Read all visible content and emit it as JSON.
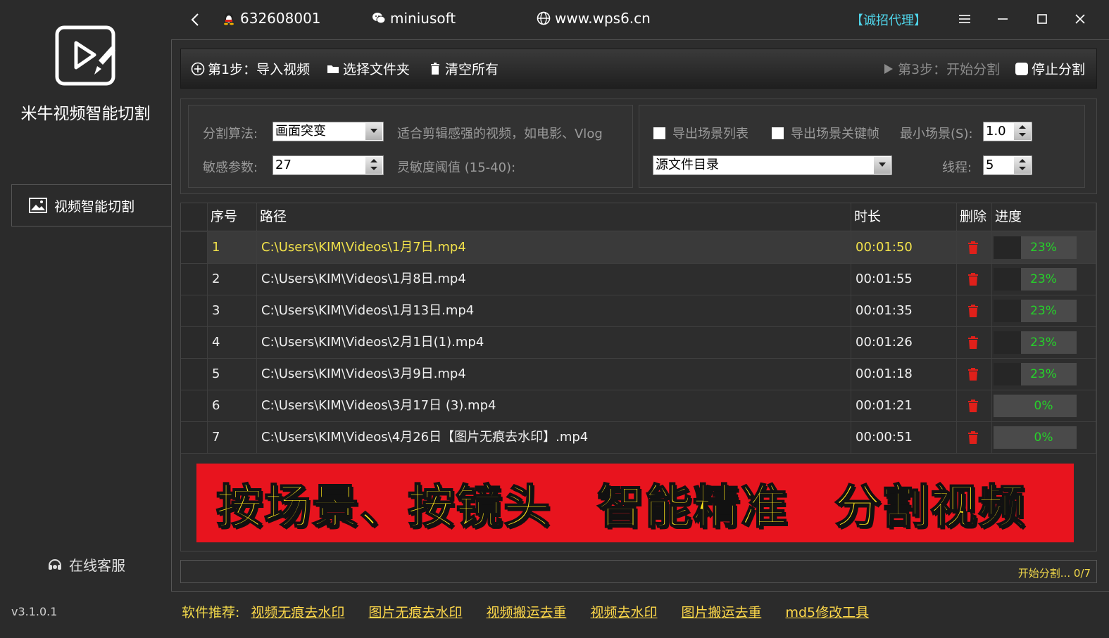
{
  "sidebar": {
    "app_title": "米牛视频智能切割",
    "nav_items": [
      {
        "label": "视频智能切割"
      }
    ],
    "support_label": "在线客服",
    "version": "v3.1.0.1"
  },
  "titlebar": {
    "qq": "632608001",
    "wechat": "miniusoft",
    "website": "www.wps6.cn",
    "agent_label": "【诚招代理】"
  },
  "toolbar": {
    "import_label": "第1步：导入视频",
    "folder_label": "选择文件夹",
    "clear_label": "清空所有",
    "start_label": "第3步：开始分割",
    "stop_label": "停止分割"
  },
  "settings": {
    "algo_label": "分割算法:",
    "algo_value": "画面突变",
    "algo_hint": "适合剪辑感强的视频，如电影、Vlog",
    "sens_label": "敏感参数:",
    "sens_value": "27",
    "sens_hint": "灵敏度阈值 (15-40):",
    "export_list_label": "导出场景列表",
    "export_key_label": "导出场景关键帧",
    "min_scene_label": "最小场景(S):",
    "min_scene_value": "1.0",
    "output_dir_value": "源文件目录",
    "thread_label": "线程:",
    "thread_value": "5"
  },
  "table": {
    "headers": {
      "index": "序号",
      "path": "路径",
      "duration": "时长",
      "delete": "删除",
      "progress": "进度"
    },
    "rows": [
      {
        "index": "1",
        "path": "C:\\Users\\KIM\\Videos\\1月7日.mp4",
        "duration": "00:01:50",
        "progress_text": "23%",
        "progress": 23,
        "selected": true
      },
      {
        "index": "2",
        "path": "C:\\Users\\KIM\\Videos\\1月8日.mp4",
        "duration": "00:01:55",
        "progress_text": "23%",
        "progress": 23
      },
      {
        "index": "3",
        "path": "C:\\Users\\KIM\\Videos\\1月13日.mp4",
        "duration": "00:01:35",
        "progress_text": "23%",
        "progress": 23
      },
      {
        "index": "4",
        "path": "C:\\Users\\KIM\\Videos\\2月1日(1).mp4",
        "duration": "00:01:26",
        "progress_text": "23%",
        "progress": 23
      },
      {
        "index": "5",
        "path": "C:\\Users\\KIM\\Videos\\3月9日.mp4",
        "duration": "00:01:18",
        "progress_text": "23%",
        "progress": 23
      },
      {
        "index": "6",
        "path": "C:\\Users\\KIM\\Videos\\3月17日 (3).mp4",
        "duration": "00:01:21",
        "progress_text": "0%",
        "progress": 0
      },
      {
        "index": "7",
        "path": "C:\\Users\\KIM\\Videos\\4月26日【图片无痕去水印】.mp4",
        "duration": "00:00:51",
        "progress_text": "0%",
        "progress": 0
      }
    ]
  },
  "banner": {
    "parts": [
      "按场景、按镜头",
      "智能精准",
      "分割视频"
    ]
  },
  "status": {
    "text": "开始分割... 0/7"
  },
  "footer": {
    "lead": "软件推荐:",
    "links": [
      "视频无痕去水印",
      "图片无痕去水印",
      "视频搬运去重",
      "视频去水印",
      "图片搬运去重",
      "md5修改工具"
    ]
  },
  "colors": {
    "accent_yellow": "#f2d94a",
    "agent_cyan": "#4fd3e8",
    "progress_green": "#26d12a",
    "banner_red": "#e8141e",
    "delete_red": "#e0201a"
  }
}
